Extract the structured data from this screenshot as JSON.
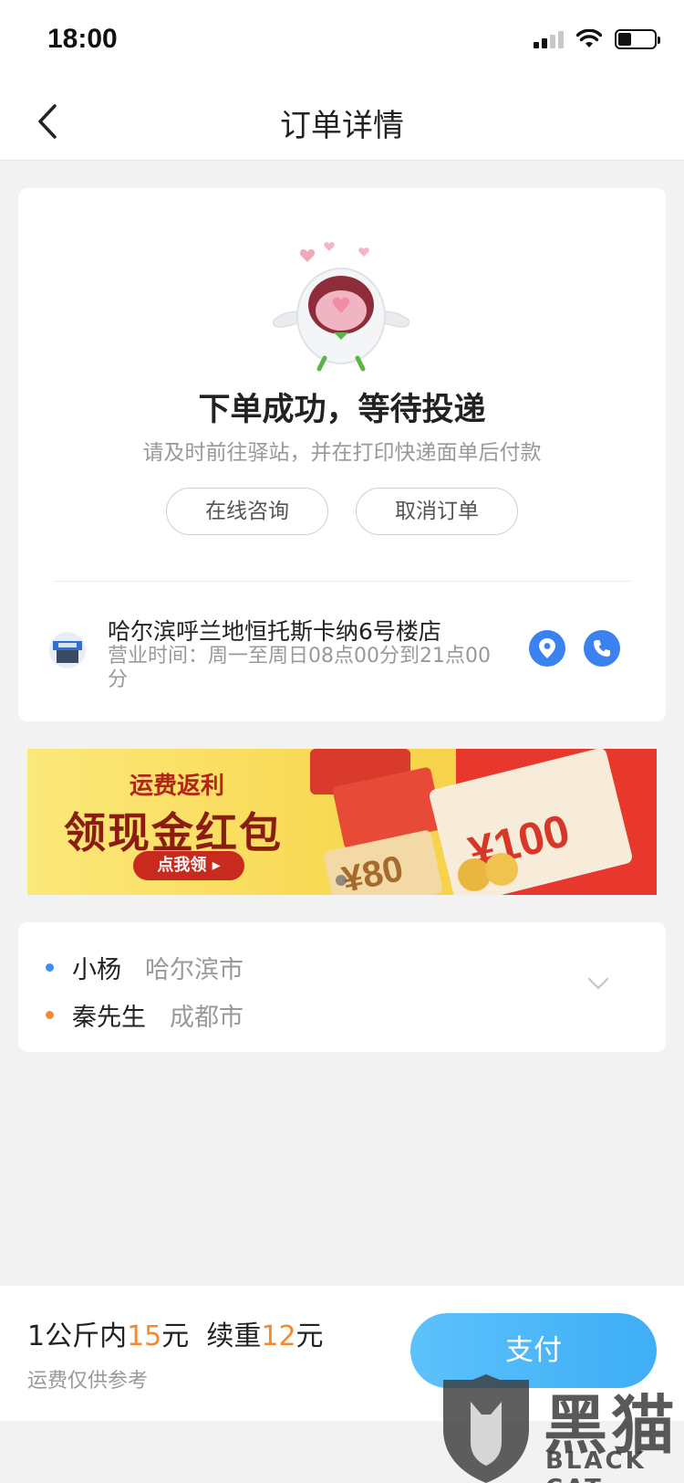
{
  "status_bar": {
    "time": "18:00"
  },
  "nav": {
    "title": "订单详情"
  },
  "order_status": {
    "title": "下单成功，等待投递",
    "subtitle": "请及时前往驿站，并在打印快递面单后付款",
    "consult_label": "在线咨询",
    "cancel_label": "取消订单"
  },
  "station": {
    "name": "哈尔滨呼兰地恒托斯卡纳6号楼店",
    "hours": "营业时间：周一至周日08点00分到21点00分"
  },
  "banner": {
    "subtitle": "运费返利",
    "title": "领现金红包",
    "button_label": "点我领 ▸"
  },
  "addresses": {
    "sender": {
      "name": "小杨",
      "city": "哈尔滨市"
    },
    "receiver": {
      "name": "秦先生",
      "city": "成都市"
    }
  },
  "price": {
    "prefix": "1公斤内",
    "first_weight_price": "15",
    "unit1": "元  续重",
    "extra_weight_price": "12",
    "unit2": "元",
    "note": "运费仅供参考"
  },
  "pay": {
    "label": "支付"
  },
  "watermark": {
    "cn": "黑猫",
    "en": "BLACK CAT"
  },
  "colors": {
    "accent_orange": "#f28a32",
    "accent_blue": "#3a82f0",
    "pay_button": "#4cb8f8"
  }
}
